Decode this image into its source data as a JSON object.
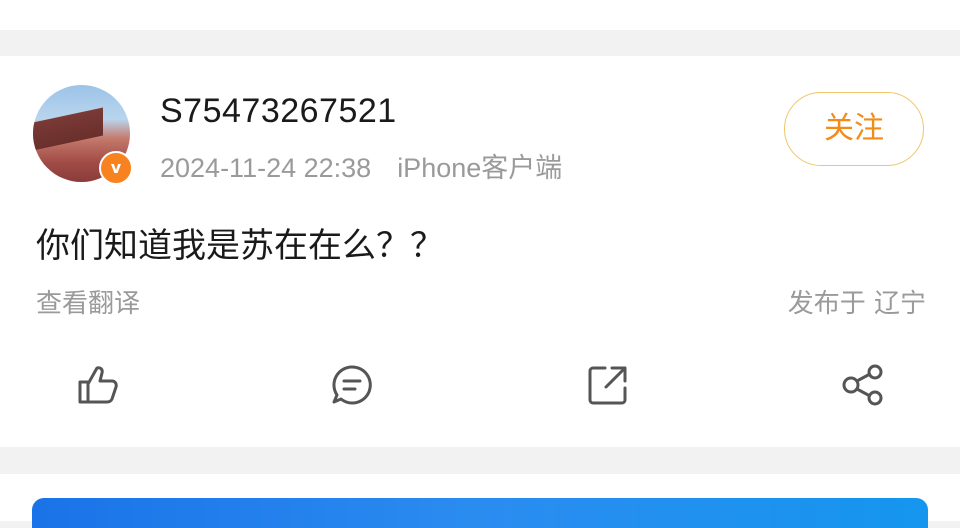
{
  "post": {
    "username": "S75473267521",
    "timestamp": "2024-11-24 22:38",
    "source": "iPhone客户端",
    "follow_label": "关注",
    "verified_badge": "v",
    "content": "你们知道我是苏在在么？？",
    "translate_label": "查看翻译",
    "location": "发布于 辽宁"
  },
  "actions": [
    {
      "icon": "like-icon"
    },
    {
      "icon": "comment-icon"
    },
    {
      "icon": "repost-icon"
    },
    {
      "icon": "share-icon"
    }
  ],
  "colors": {
    "follow_text": "#f08c17",
    "follow_border": "#f0c66a",
    "badge": "#f7821f",
    "muted_text": "#9a9a9a",
    "banner": "#1a73e8"
  }
}
